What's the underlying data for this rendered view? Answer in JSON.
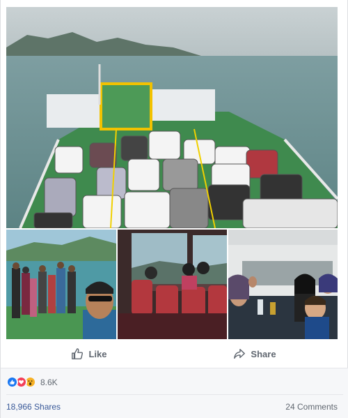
{
  "actions": {
    "like_label": "Like",
    "share_label": "Share"
  },
  "reactions": {
    "icons": [
      "like-icon",
      "love-icon",
      "wow-icon"
    ],
    "count": "8.6K"
  },
  "footer": {
    "shares": "18,966 Shares",
    "comments": "24 Comments"
  },
  "colors": {
    "link": "#385898",
    "muted": "#606770",
    "like_blue": "#1877f2",
    "love_red": "#f33e58",
    "wow_yellow": "#f7b125"
  }
}
